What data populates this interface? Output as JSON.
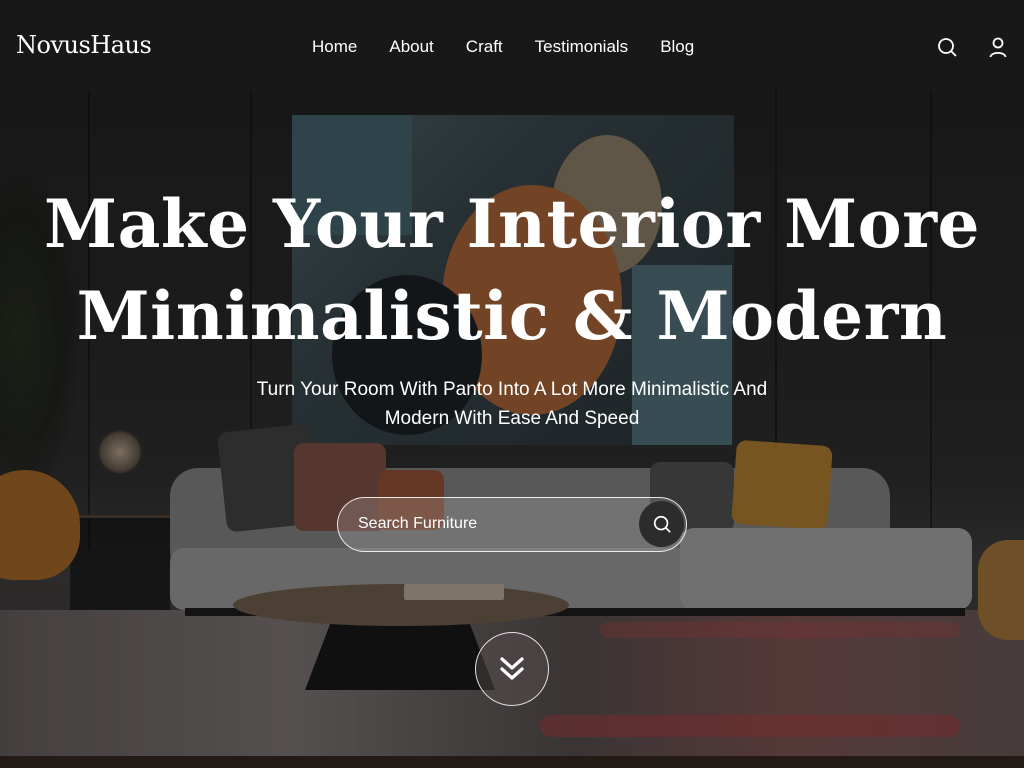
{
  "brand": {
    "name": "NovusHaus"
  },
  "nav": {
    "items": [
      {
        "label": "Home"
      },
      {
        "label": "About"
      },
      {
        "label": "Craft"
      },
      {
        "label": "Testimonials"
      },
      {
        "label": "Blog"
      }
    ]
  },
  "header_icons": {
    "search": "search-icon",
    "user": "user-icon"
  },
  "hero": {
    "title_line1": "Make Your Interior More",
    "title_line2": "Minimalistic & Modern",
    "subtitle_line1": "Turn Your Room With Panto Into A Lot More Minimalistic And",
    "subtitle_line2": "Modern With Ease And Speed"
  },
  "search": {
    "placeholder": "Search Furniture",
    "value": "",
    "button_icon": "search-icon"
  },
  "scroll": {
    "icon": "double-chevron-down-icon"
  },
  "colors": {
    "text": "#ffffff",
    "search_button_bg": "#2c2c2c"
  }
}
